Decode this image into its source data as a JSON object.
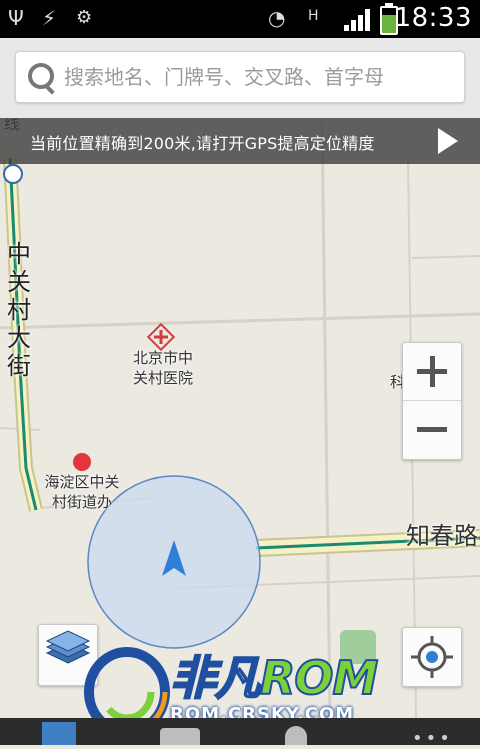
{
  "status_bar": {
    "time": "18:33",
    "network_type": "H",
    "icons": [
      "usb-icon",
      "usb-debugging-icon",
      "app-notification-icon",
      "wifi-icon",
      "signal-icon",
      "battery-charging-icon"
    ]
  },
  "search": {
    "placeholder": "搜索地名、门牌号、交叉路、首字母",
    "value": ""
  },
  "notice": {
    "text": "当前位置精确到200米,请打开GPS提高定位精度"
  },
  "map": {
    "street_labels": {
      "zhongguancun_street": "中关村大街",
      "zhichun_road": "知春路"
    },
    "pois": {
      "hospital": "北京市中关村医院",
      "hospital_line1": "北京市中",
      "hospital_line2": "关村医院",
      "office": "海淀区中关村街道办",
      "office_line1": "海淀区中关",
      "office_line2": "村街道办",
      "building": "科行大厦"
    },
    "location_accuracy_m": 200
  },
  "controls": {
    "zoom_in": "+",
    "zoom_out": "−",
    "layers": "layers-icon",
    "locate": "locate-icon"
  },
  "watermark": {
    "brand": "非凡",
    "brand_suffix": "ROM",
    "url": "ROM.CRSKY.COM"
  },
  "colors": {
    "status_bar_bg": "#000000",
    "notice_bg": "#3c3c3c",
    "map_bg": "#ece9e1",
    "road_fill": "#f5f1c4",
    "road_line": "#1a8a72",
    "accuracy_circle": "#c9d9ef",
    "location_arrow": "#2f7fd6"
  }
}
